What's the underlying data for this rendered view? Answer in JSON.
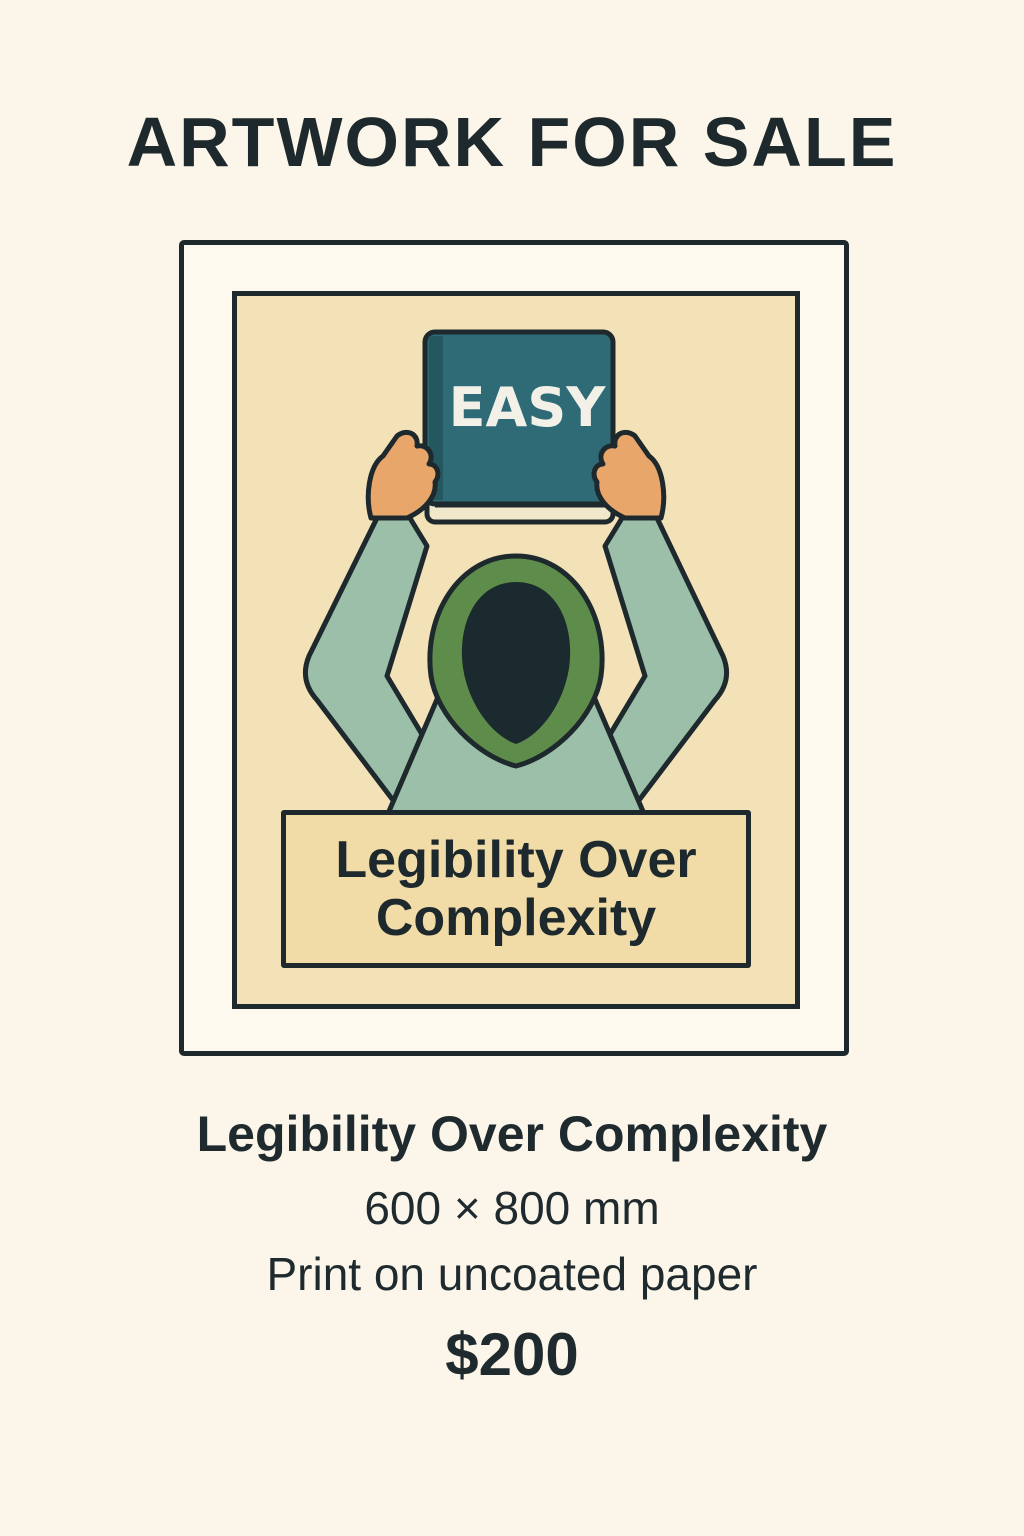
{
  "header": {
    "title": "ARTWORK FOR SALE"
  },
  "artwork": {
    "book_text": "EASY",
    "caption": "Legibility Over Complexity",
    "colors": {
      "background": "#f3e2b7",
      "book": "#2e6b77",
      "sweater": "#9bbfa8",
      "hood": "#5e8c4a",
      "skin": "#e9a66b",
      "outline": "#1e292d"
    }
  },
  "details": {
    "name": "Legibility Over Complexity",
    "dimensions": "600 × 800 mm",
    "medium": "Print on uncoated paper",
    "price": "$200"
  }
}
